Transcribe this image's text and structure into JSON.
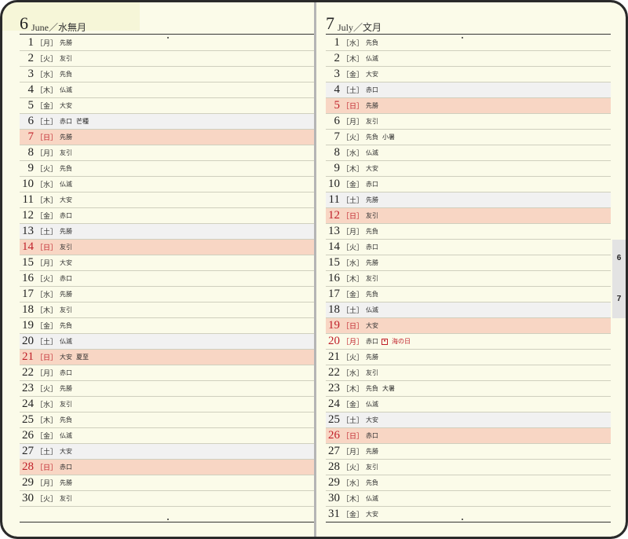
{
  "june": {
    "month_num": "6",
    "month_name": "June／水無月",
    "days": [
      {
        "d": "1",
        "w": "［月］",
        "r": "先勝",
        "e": "",
        "type": "wd"
      },
      {
        "d": "2",
        "w": "［火］",
        "r": "友引",
        "e": "",
        "type": "wd"
      },
      {
        "d": "3",
        "w": "［水］",
        "r": "先負",
        "e": "",
        "type": "wd"
      },
      {
        "d": "4",
        "w": "［木］",
        "r": "仏滅",
        "e": "",
        "type": "wd"
      },
      {
        "d": "5",
        "w": "［金］",
        "r": "大安",
        "e": "",
        "type": "wd"
      },
      {
        "d": "6",
        "w": "［土］",
        "r": "赤口",
        "e": "芒種",
        "type": "sat"
      },
      {
        "d": "7",
        "w": "［日］",
        "r": "先勝",
        "e": "",
        "type": "sun"
      },
      {
        "d": "8",
        "w": "［月］",
        "r": "友引",
        "e": "",
        "type": "wd"
      },
      {
        "d": "9",
        "w": "［火］",
        "r": "先負",
        "e": "",
        "type": "wd"
      },
      {
        "d": "10",
        "w": "［水］",
        "r": "仏滅",
        "e": "",
        "type": "wd"
      },
      {
        "d": "11",
        "w": "［木］",
        "r": "大安",
        "e": "",
        "type": "wd"
      },
      {
        "d": "12",
        "w": "［金］",
        "r": "赤口",
        "e": "",
        "type": "wd"
      },
      {
        "d": "13",
        "w": "［土］",
        "r": "先勝",
        "e": "",
        "type": "sat"
      },
      {
        "d": "14",
        "w": "［日］",
        "r": "友引",
        "e": "",
        "type": "sun"
      },
      {
        "d": "15",
        "w": "［月］",
        "r": "大安",
        "e": "",
        "type": "wd"
      },
      {
        "d": "16",
        "w": "［火］",
        "r": "赤口",
        "e": "",
        "type": "wd"
      },
      {
        "d": "17",
        "w": "［水］",
        "r": "先勝",
        "e": "",
        "type": "wd"
      },
      {
        "d": "18",
        "w": "［木］",
        "r": "友引",
        "e": "",
        "type": "wd"
      },
      {
        "d": "19",
        "w": "［金］",
        "r": "先負",
        "e": "",
        "type": "wd"
      },
      {
        "d": "20",
        "w": "［土］",
        "r": "仏滅",
        "e": "",
        "type": "sat"
      },
      {
        "d": "21",
        "w": "［日］",
        "r": "大安",
        "e": "夏至",
        "type": "sun"
      },
      {
        "d": "22",
        "w": "［月］",
        "r": "赤口",
        "e": "",
        "type": "wd"
      },
      {
        "d": "23",
        "w": "［火］",
        "r": "先勝",
        "e": "",
        "type": "wd"
      },
      {
        "d": "24",
        "w": "［水］",
        "r": "友引",
        "e": "",
        "type": "wd"
      },
      {
        "d": "25",
        "w": "［木］",
        "r": "先負",
        "e": "",
        "type": "wd"
      },
      {
        "d": "26",
        "w": "［金］",
        "r": "仏滅",
        "e": "",
        "type": "wd"
      },
      {
        "d": "27",
        "w": "［土］",
        "r": "大安",
        "e": "",
        "type": "sat"
      },
      {
        "d": "28",
        "w": "［日］",
        "r": "赤口",
        "e": "",
        "type": "sun"
      },
      {
        "d": "29",
        "w": "［月］",
        "r": "先勝",
        "e": "",
        "type": "wd"
      },
      {
        "d": "30",
        "w": "［火］",
        "r": "友引",
        "e": "",
        "type": "wd"
      }
    ]
  },
  "july": {
    "month_num": "7",
    "month_name": "July／文月",
    "days": [
      {
        "d": "1",
        "w": "［水］",
        "r": "先負",
        "e": "",
        "type": "wd"
      },
      {
        "d": "2",
        "w": "［木］",
        "r": "仏滅",
        "e": "",
        "type": "wd"
      },
      {
        "d": "3",
        "w": "［金］",
        "r": "大安",
        "e": "",
        "type": "wd"
      },
      {
        "d": "4",
        "w": "［土］",
        "r": "赤口",
        "e": "",
        "type": "sat"
      },
      {
        "d": "5",
        "w": "［日］",
        "r": "先勝",
        "e": "",
        "type": "sun"
      },
      {
        "d": "6",
        "w": "［月］",
        "r": "友引",
        "e": "",
        "type": "wd"
      },
      {
        "d": "7",
        "w": "［火］",
        "r": "先負",
        "e": "小暑",
        "type": "wd"
      },
      {
        "d": "8",
        "w": "［水］",
        "r": "仏滅",
        "e": "",
        "type": "wd"
      },
      {
        "d": "9",
        "w": "［木］",
        "r": "大安",
        "e": "",
        "type": "wd"
      },
      {
        "d": "10",
        "w": "［金］",
        "r": "赤口",
        "e": "",
        "type": "wd"
      },
      {
        "d": "11",
        "w": "［土］",
        "r": "先勝",
        "e": "",
        "type": "sat"
      },
      {
        "d": "12",
        "w": "［日］",
        "r": "友引",
        "e": "",
        "type": "sun"
      },
      {
        "d": "13",
        "w": "［月］",
        "r": "先負",
        "e": "",
        "type": "wd"
      },
      {
        "d": "14",
        "w": "［火］",
        "r": "赤口",
        "e": "",
        "type": "wd"
      },
      {
        "d": "15",
        "w": "［水］",
        "r": "先勝",
        "e": "",
        "type": "wd"
      },
      {
        "d": "16",
        "w": "［木］",
        "r": "友引",
        "e": "",
        "type": "wd"
      },
      {
        "d": "17",
        "w": "［金］",
        "r": "先負",
        "e": "",
        "type": "wd"
      },
      {
        "d": "18",
        "w": "［土］",
        "r": "仏滅",
        "e": "",
        "type": "sat"
      },
      {
        "d": "19",
        "w": "［日］",
        "r": "大安",
        "e": "",
        "type": "sun"
      },
      {
        "d": "20",
        "w": "［月］",
        "r": "赤口",
        "e": "海の日",
        "type": "hol"
      },
      {
        "d": "21",
        "w": "［火］",
        "r": "先勝",
        "e": "",
        "type": "wd"
      },
      {
        "d": "22",
        "w": "［水］",
        "r": "友引",
        "e": "",
        "type": "wd"
      },
      {
        "d": "23",
        "w": "［木］",
        "r": "先負",
        "e": "大暑",
        "type": "wd"
      },
      {
        "d": "24",
        "w": "［金］",
        "r": "仏滅",
        "e": "",
        "type": "wd"
      },
      {
        "d": "25",
        "w": "［土］",
        "r": "大安",
        "e": "",
        "type": "sat"
      },
      {
        "d": "26",
        "w": "［日］",
        "r": "赤口",
        "e": "",
        "type": "sun"
      },
      {
        "d": "27",
        "w": "［月］",
        "r": "先勝",
        "e": "",
        "type": "wd"
      },
      {
        "d": "28",
        "w": "［火］",
        "r": "友引",
        "e": "",
        "type": "wd"
      },
      {
        "d": "29",
        "w": "［水］",
        "r": "先負",
        "e": "",
        "type": "wd"
      },
      {
        "d": "30",
        "w": "［木］",
        "r": "仏滅",
        "e": "",
        "type": "wd"
      },
      {
        "d": "31",
        "w": "［金］",
        "r": "大安",
        "e": "",
        "type": "wd"
      }
    ]
  },
  "side_tabs": [
    "6",
    "7"
  ],
  "colors": {
    "paper": "#fbfbe9",
    "sunday_row": "#f8d6c4",
    "saturday_row": "#f1f1f1",
    "holiday_text": "#c0202a",
    "frame": "#2a2a2a"
  },
  "icons": {
    "holiday_flag": "flag-icon"
  }
}
